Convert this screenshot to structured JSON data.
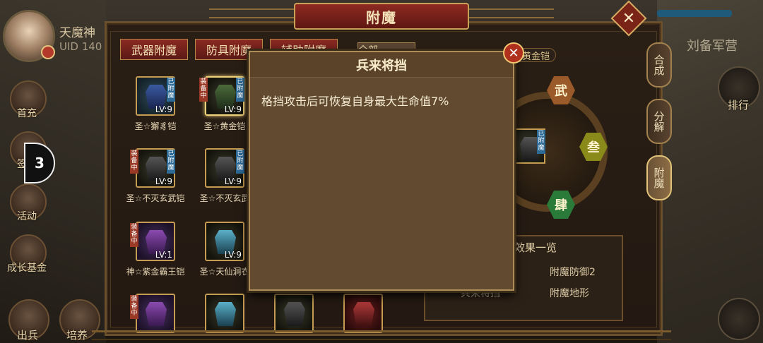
{
  "title": "附魔",
  "player": {
    "name": "天魔神",
    "uid": "UID 140"
  },
  "left_menu": [
    {
      "label": "首充",
      "icon": "gift-icon"
    },
    {
      "label": "签到",
      "icon": "calendar-icon"
    },
    {
      "label": "活动",
      "icon": "flag-icon"
    },
    {
      "label": "成长基金",
      "icon": "coin-icon"
    },
    {
      "label": "出兵",
      "icon": "sword-icon"
    },
    {
      "label": "培养",
      "icon": "scroll-icon"
    }
  ],
  "float_badge": "3",
  "right_area": {
    "camp_name": "刘备军营",
    "rank_label": "排行"
  },
  "tabs": [
    "武器附魔",
    "防具附魔",
    "辅助附魔"
  ],
  "filter_label": "全部",
  "items": [
    {
      "name": "圣☆獬豸铠",
      "level": "LV:9",
      "enchanted": "已附魔",
      "equipped": "",
      "color": "blue"
    },
    {
      "name": "圣☆黄金铠",
      "level": "LV:9",
      "enchanted": "已附魔",
      "equipped": "装备中",
      "color": "dark"
    },
    {
      "name": "圣☆不灭玄武铠",
      "level": "LV:9",
      "enchanted": "已附魔",
      "equipped": "装备中",
      "color": "black"
    },
    {
      "name": "圣☆不灭玄武",
      "level": "LV:9",
      "enchanted": "已附魔",
      "equipped": "",
      "color": "black"
    },
    {
      "name": "神☆紫金霸王铠",
      "level": "LV:1",
      "enchanted": "",
      "equipped": "装备中",
      "color": "purp"
    },
    {
      "name": "圣☆天仙洞衣",
      "level": "LV:9",
      "enchanted": "",
      "equipped": "",
      "color": "cyan"
    },
    {
      "name": "",
      "level": "",
      "enchanted": "",
      "equipped": "装备中",
      "color": "purp"
    },
    {
      "name": "",
      "level": "",
      "enchanted": "",
      "equipped": "",
      "color": "cyan"
    },
    {
      "name": "",
      "level": "",
      "enchanted": "",
      "equipped": "",
      "color": "black"
    },
    {
      "name": "",
      "level": "",
      "enchanted": "",
      "equipped": "",
      "color": "crim"
    }
  ],
  "preview": {
    "armor_name": "黄金铠",
    "enchanted": "已附魔",
    "runes": [
      "武",
      "叁",
      "肆"
    ],
    "effects_title": "效果一览",
    "effects": [
      "附魔防御2",
      "附魔地形",
      "兵来将挡"
    ]
  },
  "side_tabs": [
    "合成",
    "分解",
    "附魔"
  ],
  "modal": {
    "title": "兵来将挡",
    "description": "格挡攻击后可恢复自身最大生命值7%"
  }
}
